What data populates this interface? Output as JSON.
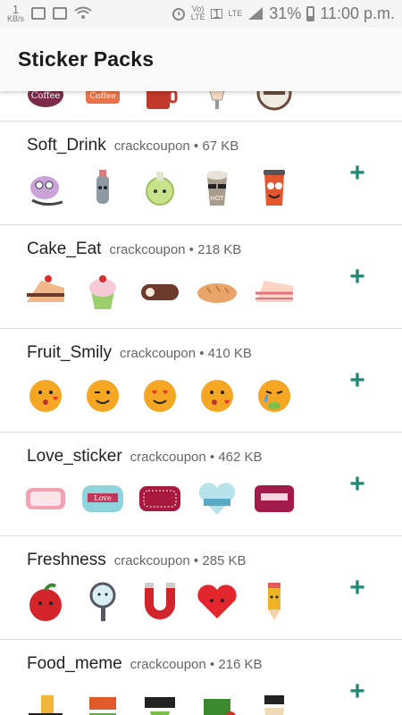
{
  "status_bar": {
    "left_top": "1",
    "left_bottom": "KB/s",
    "net_label": "Vo)\nLTE",
    "sim": "1",
    "lte": "LTE",
    "battery": "31%",
    "time": "11:00 p.m."
  },
  "app_bar": {
    "title": "Sticker Packs"
  },
  "packs": [
    {
      "name": "",
      "publisher": "",
      "size": "",
      "stickers": [
        "coffee-cup-sticker",
        "coffee-banner-sticker",
        "coffee-mug-sticker",
        "heart-glass-sticker",
        "coffee-badge-sticker"
      ]
    },
    {
      "name": "Soft_Drink",
      "publisher": "crackcoupon",
      "size": "67 KB",
      "stickers": [
        "teapot-face-sticker",
        "bottle-face-sticker",
        "potion-face-sticker",
        "hot-drink-sunglasses-sticker",
        "cup-face-sticker"
      ]
    },
    {
      "name": "Cake_Eat",
      "publisher": "crackcoupon",
      "size": "218 KB",
      "stickers": [
        "cake-slice-sticker",
        "cupcake-sticker",
        "swiss-roll-sticker",
        "bread-loaf-sticker",
        "layer-cake-sticker"
      ]
    },
    {
      "name": "Fruit_Smily",
      "publisher": "crackcoupon",
      "size": "410 KB",
      "stickers": [
        "orange-kiss-sticker",
        "orange-wink-sticker",
        "orange-love-sticker",
        "orange-kiss-heart-sticker",
        "orange-crying-sticker"
      ]
    },
    {
      "name": "Love_sticker",
      "publisher": "crackcoupon",
      "size": "462 KB",
      "stickers": [
        "love-tag-pink-sticker",
        "my-love-tag-sticker",
        "love-tag-red-sticker",
        "love-you-forever-sticker",
        "happy-love-tag-sticker"
      ]
    },
    {
      "name": "Freshness",
      "publisher": "crackcoupon",
      "size": "285 KB",
      "stickers": [
        "apple-face-sticker",
        "magnifier-face-sticker",
        "magnet-face-sticker",
        "heart-face-sticker",
        "pencil-face-sticker"
      ]
    },
    {
      "name": "Food_meme",
      "publisher": "crackcoupon",
      "size": "216 KB",
      "stickers": [
        "beer-meme-sticker",
        "eat-meme-sticker",
        "tea-meme-sticker",
        "diet-meme-sticker",
        "coffee-meme-sticker"
      ]
    }
  ],
  "add_label": "+",
  "colors": {
    "accent": "#1e8a75",
    "divider": "#dcdcdc",
    "app_bar_bg": "#fafafa"
  }
}
